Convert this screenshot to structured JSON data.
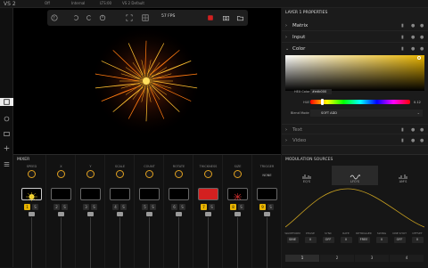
{
  "topbar": {
    "logo": "VS 2",
    "items": [
      "Off",
      "Internal",
      "LTS:00",
      "VS 2 Default"
    ]
  },
  "sidebar": {
    "icons": [
      "layers-icon",
      "output-icon",
      "media-icon",
      "effects-icon",
      "mixer-icon"
    ]
  },
  "viewport_toolbar": {
    "fps": "57 FPS",
    "icons": [
      "help-icon",
      "undo-icon",
      "redo-icon",
      "power-icon",
      "fullscreen-icon",
      "grid-icon",
      "record-icon",
      "camera-icon",
      "folder-icon"
    ]
  },
  "properties": {
    "header": "LAYER 1 PROPERTIES",
    "sections": [
      {
        "label": "Matrix",
        "open": false
      },
      {
        "label": "Input",
        "open": false
      },
      {
        "label": "Color",
        "open": true
      },
      {
        "label": "Text",
        "open": false
      },
      {
        "label": "Video",
        "open": false
      }
    ],
    "color": {
      "hex_label": "HEX Color",
      "hex_value": "#edb000",
      "hue_label": "HUE",
      "hue_value": "0.12",
      "blend_label": "Blend Mode",
      "blend_value": "SOFT ADD",
      "accent": "#e8b400"
    }
  },
  "mixer": {
    "title": "MIXER",
    "channels": [
      {
        "label": "SPEED",
        "num": "1",
        "b": "S",
        "active": true,
        "thumb": "star"
      },
      {
        "label": "X",
        "num": "2",
        "b": "S",
        "active": false,
        "thumb": ""
      },
      {
        "label": "Y",
        "num": "3",
        "b": "S",
        "active": false,
        "thumb": ""
      },
      {
        "label": "SCALE",
        "num": "4",
        "b": "S",
        "active": false,
        "thumb": ""
      },
      {
        "label": "COUNT",
        "num": "5",
        "b": "S",
        "active": false,
        "thumb": ""
      },
      {
        "label": "ROTATE",
        "num": "6",
        "b": "S",
        "active": false,
        "thumb": ""
      },
      {
        "label": "THICKNESS",
        "num": "7",
        "b": "S",
        "active": true,
        "thumb": "red"
      },
      {
        "label": "SIZE",
        "num": "8",
        "b": "S",
        "active": true,
        "thumb": "redstar"
      },
      {
        "label": "TRIGGER",
        "num": "9",
        "b": "S",
        "active": true,
        "thumb": ""
      }
    ],
    "trigger_value": "NONE"
  },
  "modulation": {
    "title": "MODULATION SOURCES",
    "tabs": [
      "EQ'S",
      "LFO'S",
      "AM'S"
    ],
    "active_tab": "LFO'S",
    "params": [
      {
        "label": "WAVEFORM",
        "value": "SINE"
      },
      {
        "label": "PHASE",
        "value": "0"
      },
      {
        "label": "SYNC",
        "value": "OFF"
      },
      {
        "label": "RATE",
        "value": "0"
      },
      {
        "label": "RETRIGGER",
        "value": "FREE"
      },
      {
        "label": "SWING",
        "value": "0"
      },
      {
        "label": "ONE SHOT",
        "value": "OFF"
      },
      {
        "label": "OFFSET",
        "value": "0"
      }
    ],
    "pages": [
      "1",
      "2",
      "3",
      "4"
    ],
    "active_page": "1"
  }
}
